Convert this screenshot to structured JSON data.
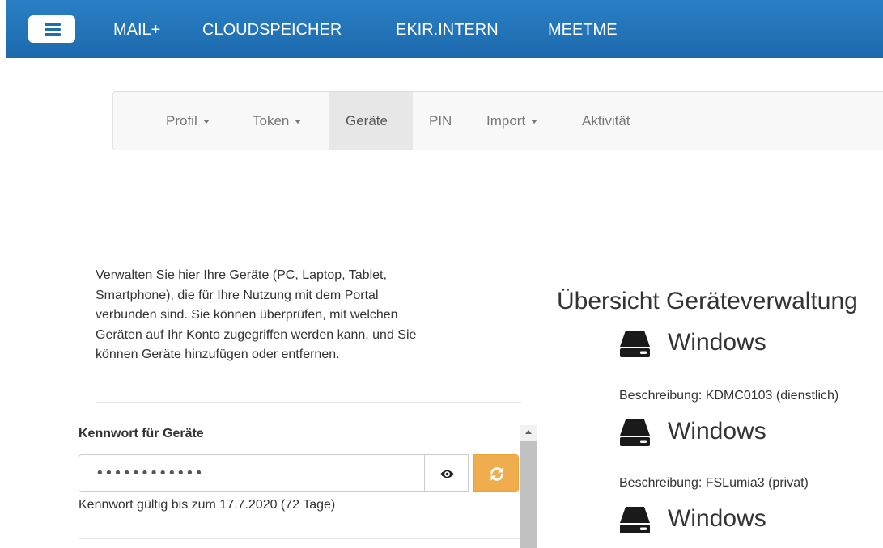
{
  "topbar": {
    "menu_icon": "hamburger-icon",
    "nav": [
      "MAIL+",
      "CLOUDSPEICHER",
      "EKIR.INTERN",
      "MEETME"
    ]
  },
  "subnav": {
    "items": [
      {
        "label": "Profil",
        "dropdown": true
      },
      {
        "label": "Token",
        "dropdown": true
      },
      {
        "label": "Geräte",
        "dropdown": false,
        "active": true
      },
      {
        "label": "PIN",
        "dropdown": false
      },
      {
        "label": "Import",
        "dropdown": true
      },
      {
        "label": "Aktivität",
        "dropdown": false
      }
    ]
  },
  "intro": {
    "line1": "Verwalten Sie hier Ihre Geräte (PC, Laptop, Tablet,",
    "line2": "Smartphone), die für Ihre Nutzung mit dem Portal",
    "line3": "verbunden sind. Sie können überprüfen, mit welchen",
    "line4": "Geräten auf Ihr Konto zugegriffen werden kann, und Sie",
    "line5": "können Geräte hinzufügen oder entfernen."
  },
  "password": {
    "label": "Kennwort für Geräte",
    "value": "••••••••••••",
    "show_icon": "eye-icon",
    "refresh_icon": "refresh-icon",
    "validity": "Kennwort gültig bis zum 17.7.2020 (72 Tage)"
  },
  "overview": {
    "title": "Übersicht Geräteverwaltung",
    "devices": [
      {
        "icon": "hard-drive-icon",
        "name": "Windows",
        "description": "Beschreibung: KDMC0103 (dienstlich)"
      },
      {
        "icon": "hard-drive-icon",
        "name": "Windows",
        "description": "Beschreibung: FSLumia3 (privat)"
      },
      {
        "icon": "hard-drive-icon",
        "name": "Windows"
      }
    ]
  },
  "colors": {
    "topbar": "#1d6db0",
    "warning_button": "#f0ad4e",
    "subnav_active": "#e7e7e7"
  }
}
